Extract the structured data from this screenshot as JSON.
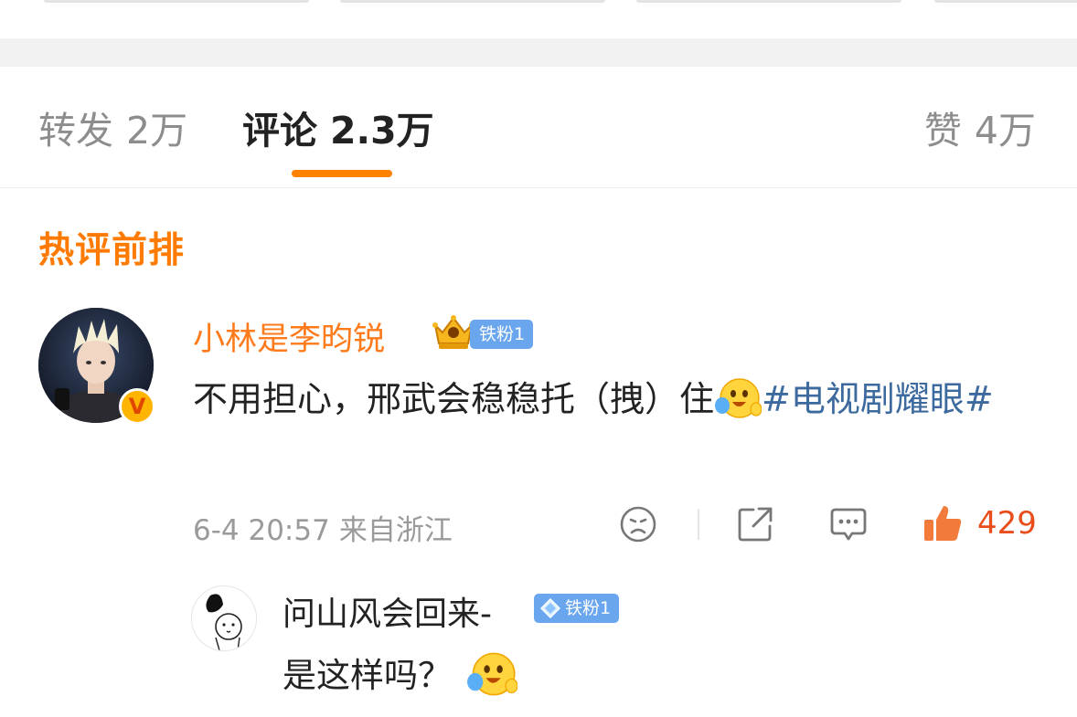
{
  "tabs": {
    "repost": {
      "label": "转发",
      "count": "2万"
    },
    "comment": {
      "label": "评论",
      "count": "2.3万"
    },
    "like": {
      "label": "赞",
      "count": "4万"
    }
  },
  "section_title": "热评前排",
  "comment": {
    "username": "小林是李昀锐",
    "verified_badge": "V",
    "fan_badge": "铁粉1",
    "text_part1": "不用担心，邢武会稳稳托（拽）住",
    "hashtag": "#电视剧耀眼#",
    "time": "6-4 20:57",
    "location": "来自浙江",
    "like_count": "429"
  },
  "reply": {
    "username": "问山风会回来-",
    "fan_badge": "铁粉1",
    "text": "是这样吗？"
  },
  "colors": {
    "accent_orange": "#ff8200",
    "username_orange": "#ff7a1a",
    "hashtag_blue": "#3d6a9e",
    "badge_blue": "#6aa6ee",
    "like_red": "#e84d1a"
  },
  "icons": [
    "crown-icon",
    "diamond-icon",
    "hug-emoji-icon",
    "sad-face-icon",
    "share-icon",
    "comment-icon",
    "thumbs-up-icon"
  ]
}
